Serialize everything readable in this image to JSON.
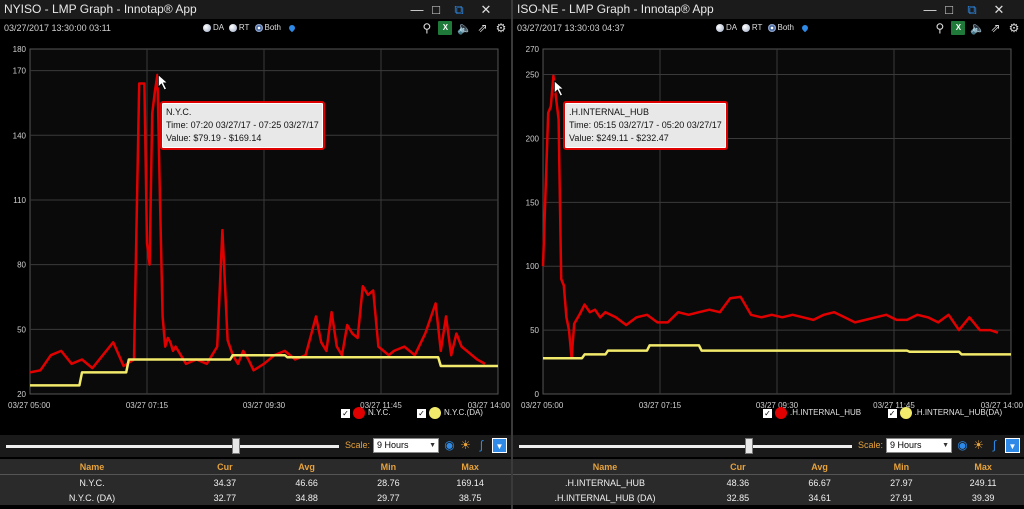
{
  "accent": "#e6a23c",
  "rt_color": "#e00000",
  "da_color": "#f2ea6a",
  "left": {
    "title": "NYISO - LMP Graph - Innotap® App",
    "info": "03/27/2017  13:30:00   03:11",
    "radio_da": "DA",
    "radio_rt": "RT",
    "radio_both": "Both",
    "tooltip": {
      "name": "N.Y.C.",
      "time": "Time: 07:20 03/27/17 - 07:25 03/27/17",
      "value": "Value: $79.19 - $169.14"
    },
    "legend_rt": "N.Y.C.",
    "legend_da": "N.Y.C.(DA)",
    "scale_label": "Scale:",
    "scale_value": "9 Hours",
    "headers": [
      "Name",
      "Cur",
      "Avg",
      "Min",
      "Max"
    ],
    "rows": [
      [
        "N.Y.C.",
        "34.37",
        "46.66",
        "28.76",
        "169.14"
      ],
      [
        "N.Y.C. (DA)",
        "32.77",
        "34.88",
        "29.77",
        "38.75"
      ]
    ],
    "slider_value": 0.72
  },
  "right": {
    "title": "ISO-NE - LMP Graph - Innotap® App",
    "info": "03/27/2017  13:30:03   04:37",
    "radio_da": "DA",
    "radio_rt": "RT",
    "radio_both": "Both",
    "tooltip": {
      "name": ".H.INTERNAL_HUB",
      "time": "Time: 05:15 03/27/17 - 05:20 03/27/17",
      "value": "Value: $249.11 - $232.47"
    },
    "legend_rt": ".H.INTERNAL_HUB",
    "legend_da": ".H.INTERNAL_HUB(DA)",
    "scale_label": "Scale:",
    "scale_value": "9 Hours",
    "headers": [
      "Name",
      "Cur",
      "Avg",
      "Min",
      "Max"
    ],
    "rows": [
      [
        ".H.INTERNAL_HUB",
        "48.36",
        "66.67",
        "27.97",
        "249.11"
      ],
      [
        ".H.INTERNAL_HUB (DA)",
        "32.85",
        "34.61",
        "27.91",
        "39.39"
      ]
    ],
    "slider_value": 0.72
  },
  "chart_data": [
    {
      "type": "line",
      "ylim": [
        20,
        180
      ],
      "yticks": [
        "20",
        "50",
        "80",
        "110",
        "140",
        "170",
        "180"
      ],
      "xlabels": [
        "03/27 05:00",
        "03/27 07:15",
        "03/27 09:30",
        "03/27 11:45",
        "03/27 14:00"
      ],
      "x_hours": [
        0,
        9
      ],
      "series": [
        {
          "name": "N.Y.C.",
          "x": [
            0,
            0.2,
            0.4,
            0.6,
            0.8,
            1.0,
            1.2,
            1.4,
            1.6,
            1.8,
            2.0,
            2.1,
            2.2,
            2.25,
            2.3,
            2.35,
            2.4,
            2.45,
            2.5,
            2.55,
            2.6,
            2.65,
            2.7,
            2.75,
            2.8,
            2.9,
            3.0,
            3.2,
            3.4,
            3.6,
            3.7,
            3.8,
            3.9,
            4.0,
            4.1,
            4.2,
            4.3,
            4.5,
            4.7,
            4.9,
            5.1,
            5.3,
            5.5,
            5.6,
            5.7,
            5.8,
            5.9,
            6.0,
            6.1,
            6.2,
            6.3,
            6.4,
            6.5,
            6.6,
            6.7,
            6.8,
            6.9,
            7.0,
            7.2,
            7.4,
            7.6,
            7.8,
            7.9,
            8.0,
            8.1,
            8.2,
            8.3,
            8.4,
            8.5,
            8.6,
            8.75
          ],
          "values": [
            30,
            31,
            38,
            40,
            34,
            36,
            32,
            38,
            44,
            33,
            36,
            164,
            164,
            90,
            80,
            150,
            160,
            168,
            110,
            56,
            42,
            46,
            44,
            40,
            42,
            38,
            34,
            36,
            34,
            42,
            96,
            45,
            38,
            34,
            40,
            36,
            31,
            34,
            38,
            40,
            36,
            38,
            56,
            44,
            40,
            58,
            42,
            38,
            52,
            48,
            46,
            70,
            66,
            68,
            42,
            40,
            38,
            40,
            42,
            38,
            48,
            62,
            40,
            56,
            38,
            48,
            42,
            40,
            38,
            36,
            34
          ]
        },
        {
          "name": "N.Y.C.(DA)",
          "x": [
            0,
            0.95,
            1.0,
            1.85,
            1.9,
            3.85,
            3.9,
            4.9,
            4.95,
            7.85,
            7.9,
            9.0
          ],
          "values": [
            24,
            24,
            30,
            30,
            36,
            36,
            38,
            38,
            37,
            37,
            33,
            33
          ]
        }
      ]
    },
    {
      "type": "line",
      "ylim": [
        0,
        270
      ],
      "yticks": [
        "0",
        "50",
        "100",
        "150",
        "200",
        "250",
        "270"
      ],
      "xlabels": [
        "03/27 05:00",
        "03/27 07:15",
        "03/27 09:30",
        "03/27 11:45",
        "03/27 14:00"
      ],
      "x_hours": [
        0,
        9
      ],
      "series": [
        {
          "name": ".H.INTERNAL_HUB",
          "x": [
            0,
            0.1,
            0.15,
            0.2,
            0.25,
            0.3,
            0.35,
            0.4,
            0.45,
            0.5,
            0.55,
            0.6,
            0.7,
            0.8,
            0.9,
            1.0,
            1.1,
            1.2,
            1.3,
            1.4,
            1.6,
            1.8,
            2.0,
            2.2,
            2.4,
            2.6,
            2.8,
            3.0,
            3.2,
            3.4,
            3.6,
            3.8,
            4.0,
            4.2,
            4.4,
            4.6,
            4.8,
            5.0,
            5.2,
            5.4,
            5.6,
            5.8,
            6.0,
            6.2,
            6.4,
            6.6,
            6.8,
            7.0,
            7.2,
            7.4,
            7.6,
            7.8,
            8.0,
            8.2,
            8.4,
            8.6,
            8.75
          ],
          "values": [
            100,
            220,
            225,
            249,
            232,
            215,
            90,
            85,
            60,
            50,
            28,
            55,
            62,
            70,
            64,
            66,
            60,
            64,
            62,
            60,
            54,
            60,
            62,
            56,
            56,
            64,
            62,
            64,
            66,
            64,
            75,
            76,
            62,
            60,
            62,
            60,
            62,
            60,
            58,
            62,
            64,
            60,
            56,
            58,
            60,
            62,
            58,
            58,
            62,
            60,
            56,
            62,
            50,
            60,
            50,
            50,
            48
          ]
        },
        {
          "name": ".H.INTERNAL_HUB(DA)",
          "x": [
            0,
            0.75,
            0.8,
            1.2,
            1.25,
            2.0,
            2.05,
            3.0,
            3.05,
            7.0,
            7.05,
            8.0,
            8.05,
            9.0
          ],
          "values": [
            28,
            28,
            31,
            31,
            34,
            34,
            38,
            38,
            34,
            34,
            33,
            33,
            31,
            31
          ]
        }
      ]
    }
  ]
}
